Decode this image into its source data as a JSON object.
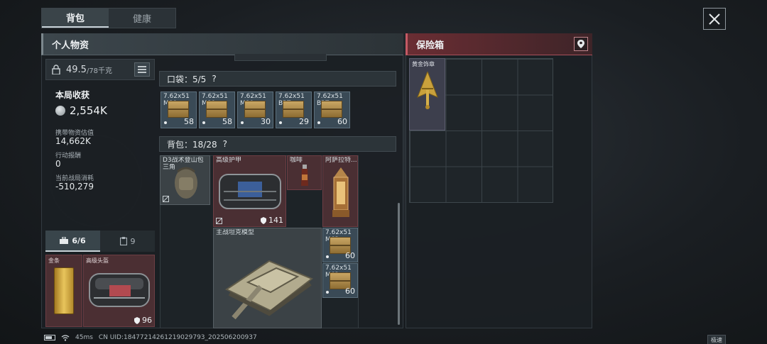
{
  "tabs": [
    {
      "label": "背包",
      "active": true
    },
    {
      "label": "健康",
      "active": false
    }
  ],
  "personal": {
    "title": "个人物资"
  },
  "safe": {
    "title": "保险箱",
    "item_label": "黄金饰章"
  },
  "weight": {
    "value": "49.5",
    "unit": "/78千克"
  },
  "stats": {
    "title": "本局收获",
    "value": "2,554K",
    "carry_label": "携带物资估值",
    "carry_value": "14,662K",
    "reward_label": "行动报酬",
    "reward_value": "0",
    "cost_label": "当前战局消耗",
    "cost_value": "-510,279"
  },
  "sub_tabs": [
    {
      "label": "6/6",
      "icon": "toolbox-icon",
      "active": true
    },
    {
      "label": "9",
      "icon": "clipboard-icon",
      "active": false
    }
  ],
  "equipment": [
    {
      "label": "金条",
      "icon": "gold-bar-icon"
    },
    {
      "label": "高级头盔",
      "icon": "helmet-icon",
      "durability": "96"
    }
  ],
  "pocket": {
    "title": "口袋：5/5",
    "items": [
      {
        "label": "7.62x51 M80",
        "count": "58"
      },
      {
        "label": "7.62x51 M80",
        "count": "58"
      },
      {
        "label": "7.62x51 M80",
        "count": "30"
      },
      {
        "label": "7.62x51 BPZ",
        "count": "29"
      },
      {
        "label": "7.62x51 BPZ",
        "count": "60"
      }
    ]
  },
  "backpack": {
    "title": "背包：18/28",
    "items": [
      {
        "label": "D3战术登山包",
        "sublabel": "三角",
        "icon": "backpack-icon"
      },
      {
        "label": "高级护甲",
        "icon": "armor-icon",
        "durability": "141"
      },
      {
        "label": "咖啡",
        "icon": "coffee-icon"
      },
      {
        "label": "阿萨拉特...",
        "icon": "lantern-icon"
      },
      {
        "label": "主战坦克模型",
        "icon": "tank-model-icon"
      },
      {
        "label": "7.62x51 M62",
        "count": "60"
      },
      {
        "label": "7.62x51 M62",
        "count": "60"
      }
    ]
  },
  "status": {
    "ping": "45ms",
    "uid": "CN UID:18477214261219029793_202506200937",
    "speed": "极速"
  },
  "colors": {
    "safe_accent": "#c45964",
    "panel": "#1b2024",
    "ammo_bg": "#3a4a56"
  }
}
